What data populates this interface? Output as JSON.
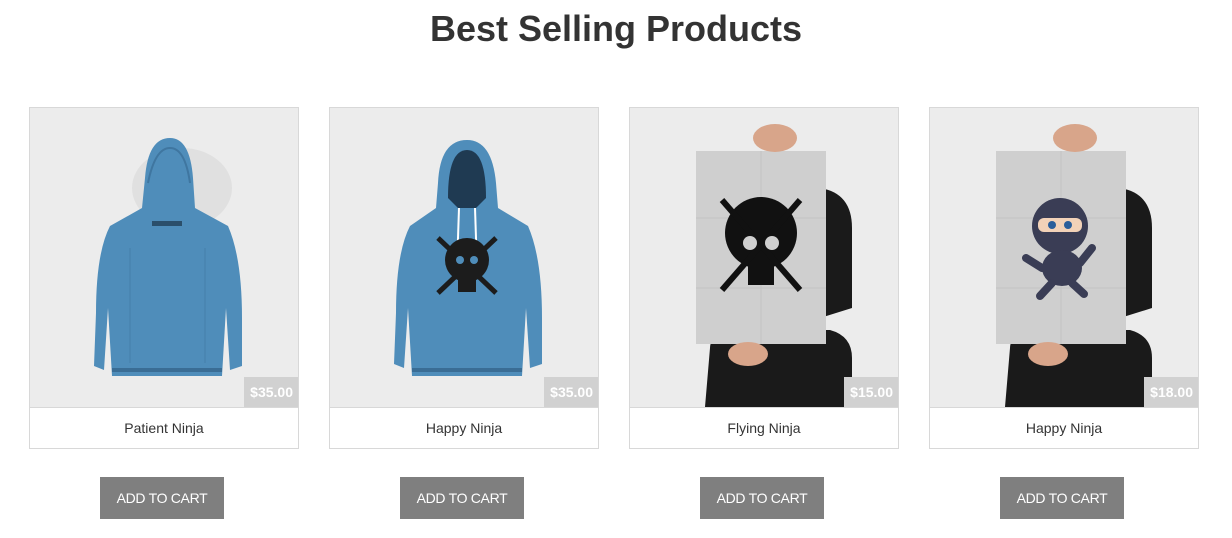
{
  "section": {
    "title": "Best Selling Products"
  },
  "products": [
    {
      "name": "Patient Ninja",
      "price": "$35.00",
      "button_label": "ADD TO CART",
      "image": "hoodie-back-icon"
    },
    {
      "name": "Happy Ninja",
      "price": "$35.00",
      "button_label": "ADD TO CART",
      "image": "hoodie-front-skull-icon"
    },
    {
      "name": "Flying Ninja",
      "price": "$15.00",
      "button_label": "ADD TO CART",
      "image": "poster-skull-icon"
    },
    {
      "name": "Happy Ninja",
      "price": "$18.00",
      "button_label": "ADD TO CART",
      "image": "poster-ninja-icon"
    }
  ],
  "colors": {
    "hoodie": "#4f8dba",
    "button": "#7f7f7f",
    "badge": "#d1d1d1",
    "image_bg": "#ececec"
  }
}
